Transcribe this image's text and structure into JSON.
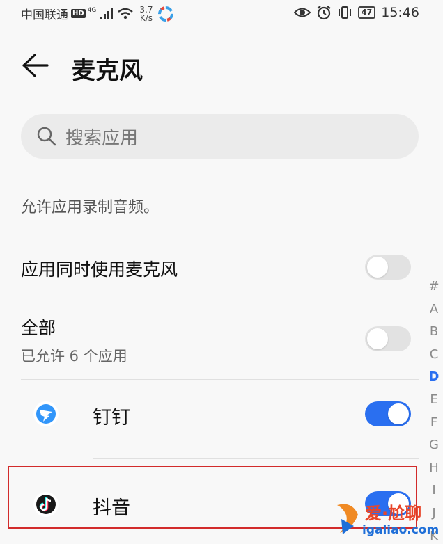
{
  "status_bar": {
    "carrier": "中国联通",
    "hd": "HD",
    "network": "4G",
    "speed_value": "3.7",
    "speed_unit": "K/s",
    "battery": "47",
    "time": "15:46"
  },
  "header": {
    "back_icon": "arrow-left",
    "title": "麦克风"
  },
  "search": {
    "placeholder": "搜索应用"
  },
  "description": "允许应用录制音频。",
  "settings": {
    "concurrent": {
      "label": "应用同时使用麦克风",
      "enabled": false
    },
    "all": {
      "label": "全部",
      "sub": "已允许 6 个应用",
      "enabled": false
    }
  },
  "apps": [
    {
      "name": "钉钉",
      "icon": "dingtalk-icon",
      "enabled": true
    },
    {
      "name": "抖音",
      "icon": "douyin-icon",
      "enabled": true
    }
  ],
  "alphabet_index": {
    "letters": [
      "#",
      "A",
      "B",
      "C",
      "D",
      "E",
      "F",
      "G",
      "H",
      "I",
      "J",
      "K"
    ],
    "active": "D"
  },
  "watermark": {
    "text": "爱·尬聊",
    "url": "igaliao.com"
  },
  "colors": {
    "accent": "#2a6ff0",
    "toggle_off": "#e2e2e2",
    "highlight": "#d22b2b"
  }
}
